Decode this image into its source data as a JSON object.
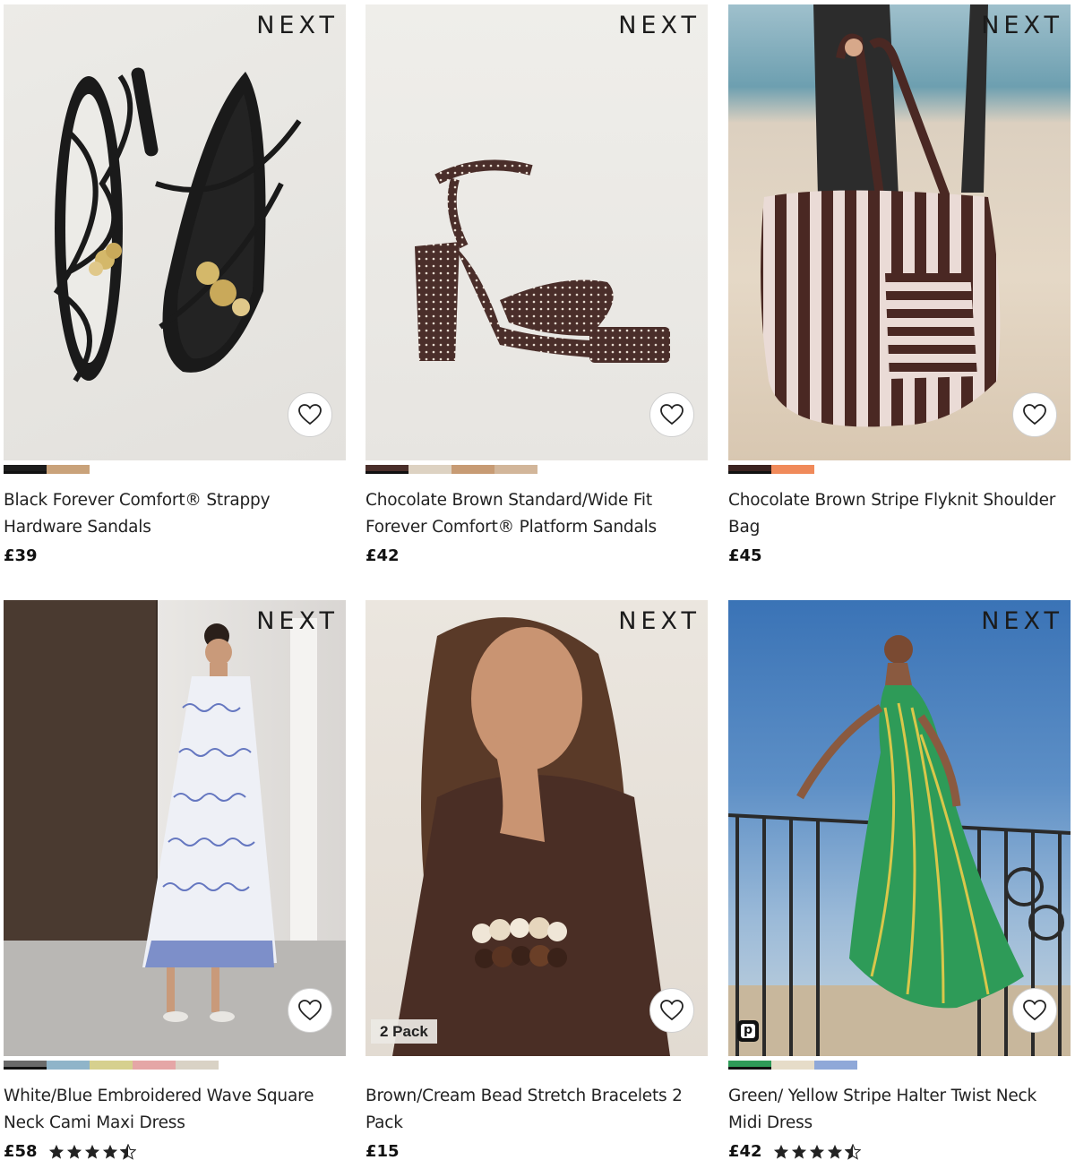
{
  "brand": "NEXT",
  "products": [
    {
      "name": "Black Forever Comfort® Strappy Hardware Sandals",
      "price": "£39",
      "swatches": [
        "#1c1c1c",
        "#c9a27a"
      ],
      "selected_swatch": 0,
      "badge": "",
      "rating": null
    },
    {
      "name": "Chocolate Brown Standard/Wide Fit Forever Comfort® Platform Sandals",
      "price": "£42",
      "swatches": [
        "#4a2e2a",
        "#ddd2c2",
        "#c79b74",
        "#d2b69a"
      ],
      "selected_swatch": 0,
      "badge": "",
      "rating": null
    },
    {
      "name": "Chocolate Brown Stripe Flyknit Shoulder Bag",
      "price": "£45",
      "swatches": [
        "#3b2320",
        "#f08a5a"
      ],
      "selected_swatch": 0,
      "badge": "",
      "rating": null
    },
    {
      "name": "White/Blue Embroidered Wave Square Neck Cami Maxi Dress",
      "price": "£58",
      "swatches": [
        "#6a6a6a",
        "#8fb4c9",
        "#d6d08e",
        "#e5a6a6",
        "#d9d2c5"
      ],
      "selected_swatch": 0,
      "badge": "",
      "rating": 4.5
    },
    {
      "name": "Brown/Cream Bead Stretch Bracelets 2 Pack",
      "price": "£15",
      "swatches": [],
      "selected_swatch": -1,
      "badge": "2 Pack",
      "rating": null
    },
    {
      "name": "Green/ Yellow Stripe Halter Twist Neck Midi Dress",
      "price": "£42",
      "swatches": [
        "#2e9b58",
        "#e6dcc8",
        "#8fa8d8"
      ],
      "selected_swatch": 0,
      "badge": "p",
      "rating": 4.5
    }
  ],
  "icons": {
    "favourite": "heart-outline-icon",
    "rating": "star-icon"
  }
}
